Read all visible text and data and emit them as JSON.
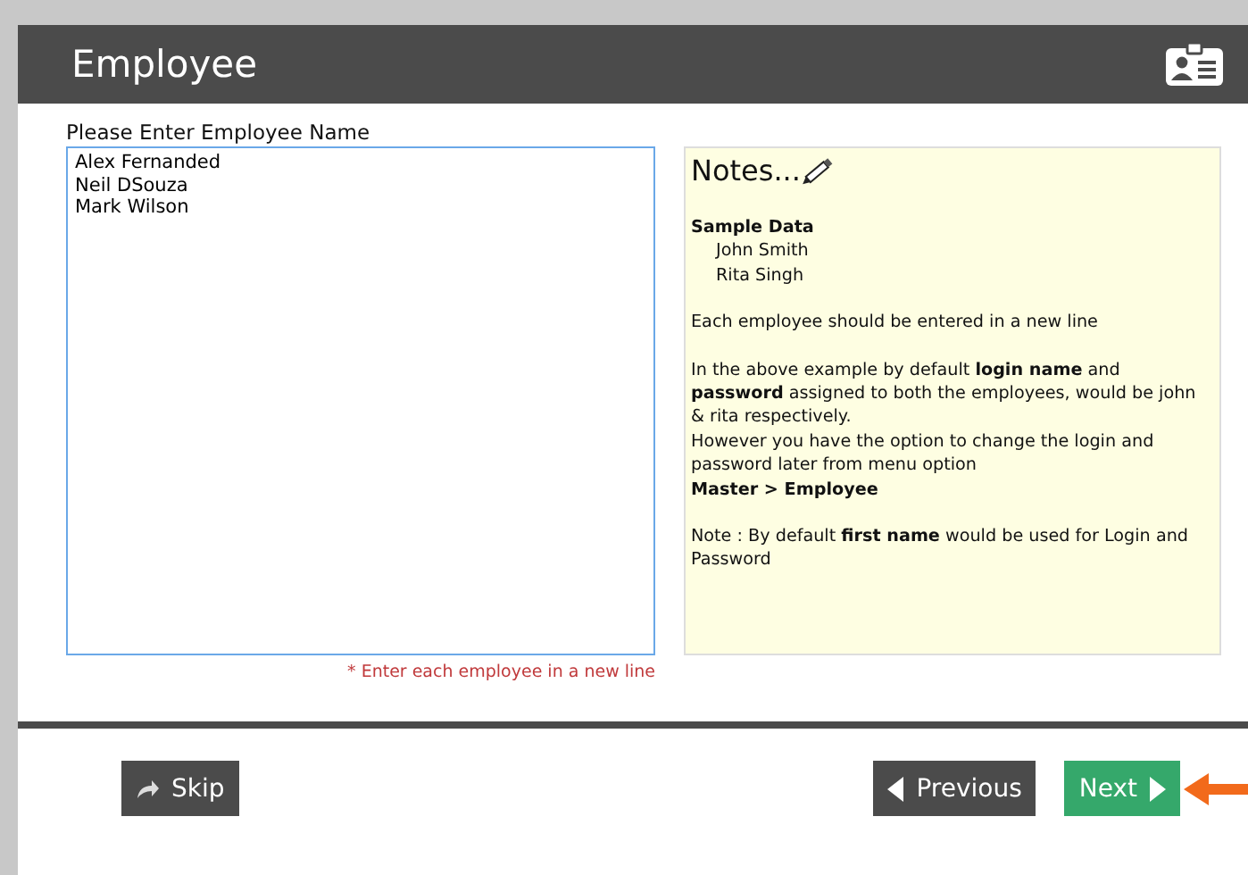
{
  "header": {
    "title": "Employee"
  },
  "form": {
    "label": "Please Enter Employee Name",
    "names": [
      "Alex Fernanded",
      "Neil DSouza",
      "Mark Wilson"
    ],
    "hint": "* Enter each employee in a new line"
  },
  "notes": {
    "title": "Notes...",
    "sections": [
      [
        {
          "kind": "heading",
          "text": "Sample Data"
        },
        {
          "kind": "indent",
          "text": "John Smith"
        },
        {
          "kind": "indent",
          "text": "Rita Singh"
        }
      ],
      [
        {
          "kind": "text",
          "text": "Each employee should be entered in a new line"
        }
      ],
      [
        {
          "kind": "text",
          "text": "In the above example by default **login name** and **password** assigned to both the employees, would be john & rita respectively."
        },
        {
          "kind": "text",
          "text": "However you have the option to change the login and password later from menu option"
        },
        {
          "kind": "heading",
          "text": "Master > Employee"
        }
      ],
      [
        {
          "kind": "text",
          "text": "Note : By default **first name** would be used for Login and Password"
        }
      ]
    ]
  },
  "buttons": [
    {
      "kind": "skip",
      "label": "Skip"
    },
    {
      "kind": "previous",
      "label": "Previous"
    },
    {
      "kind": "next",
      "label": "Next"
    }
  ]
}
